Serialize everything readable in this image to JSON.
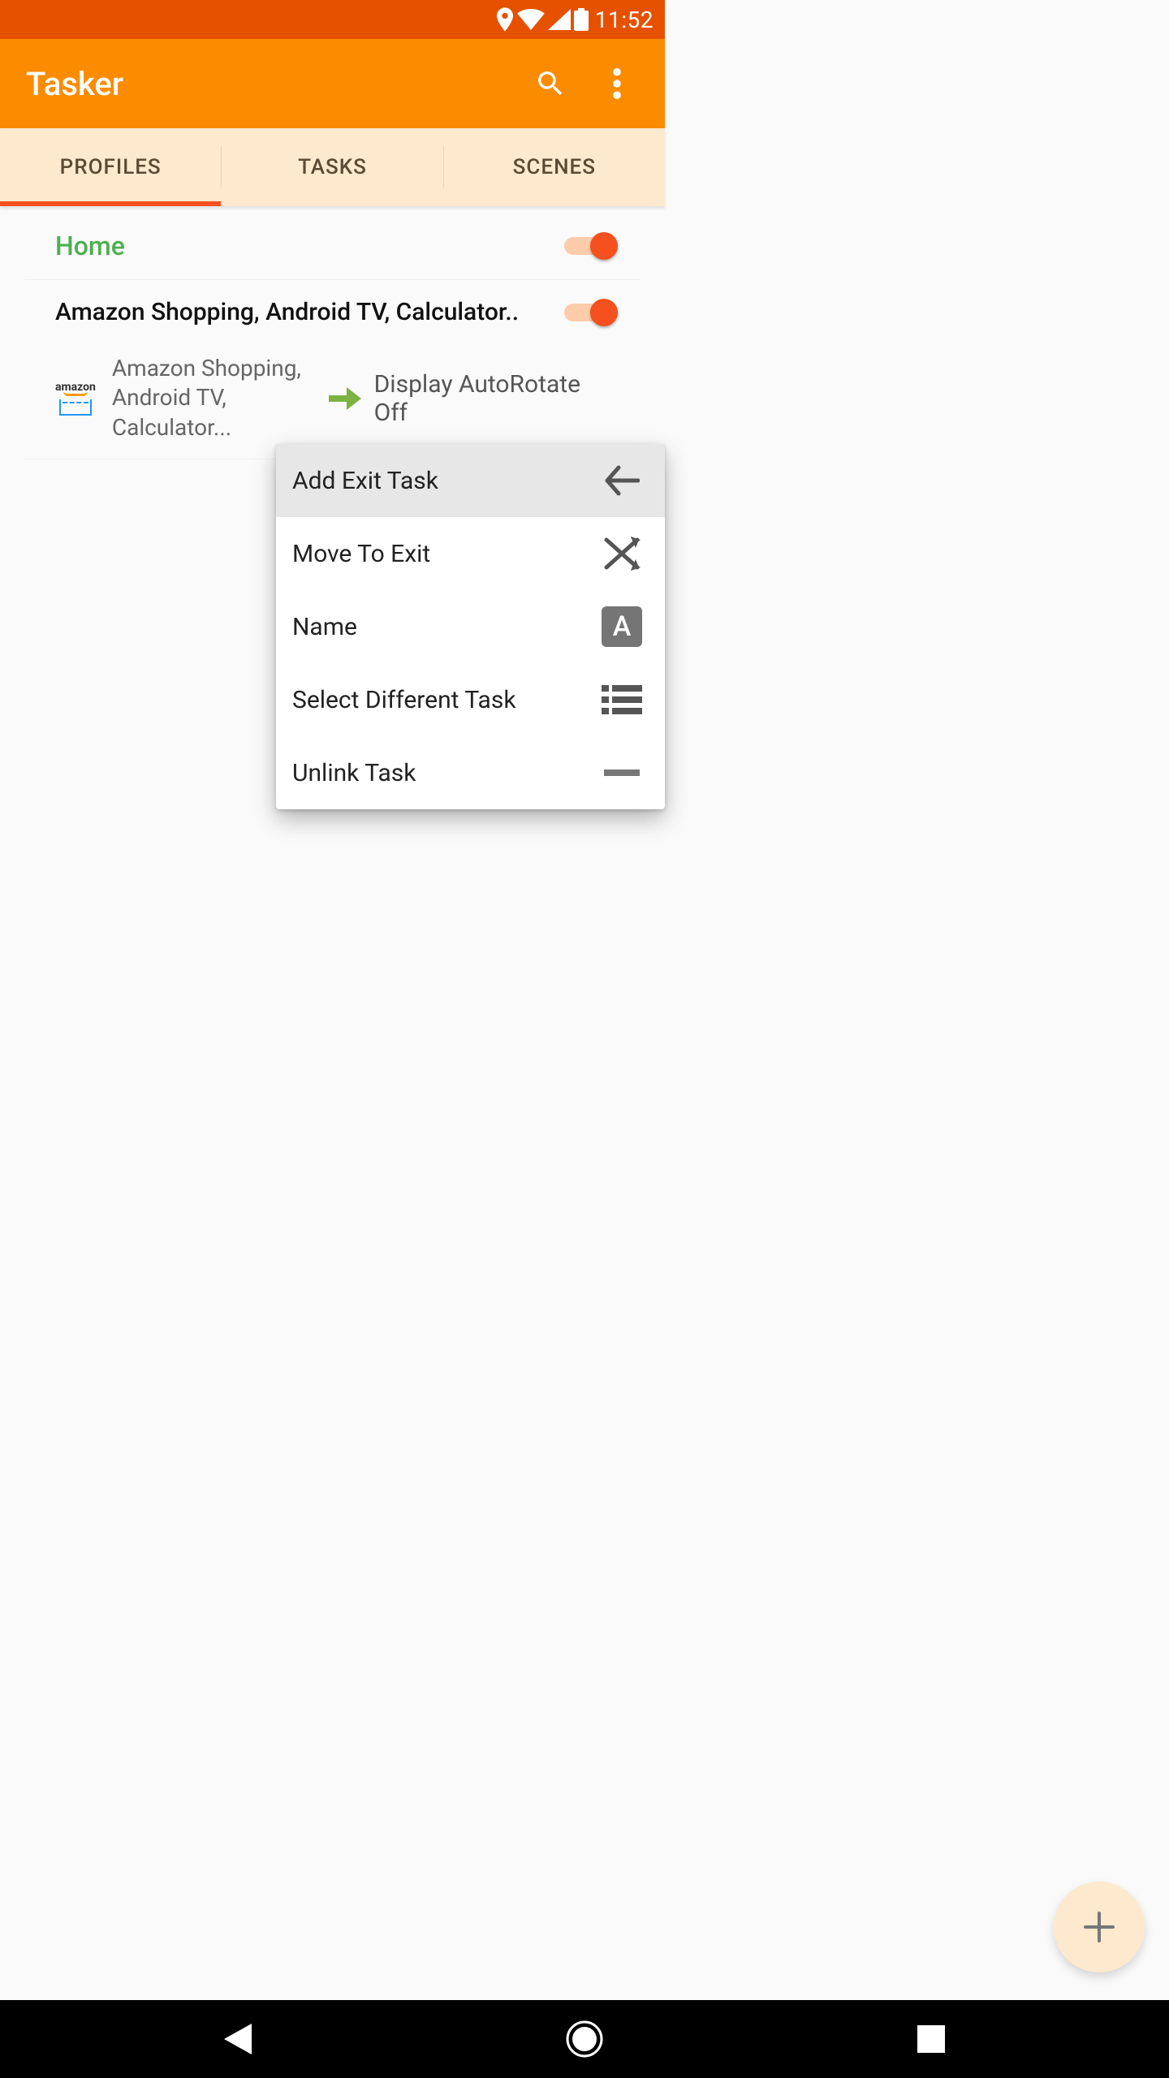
{
  "status": {
    "time": "11:52"
  },
  "appbar": {
    "title": "Tasker"
  },
  "tabs": {
    "items": [
      {
        "label": "PROFILES"
      },
      {
        "label": "TASKS"
      },
      {
        "label": "SCENES"
      }
    ]
  },
  "profiles": {
    "home": {
      "title": "Home"
    },
    "second": {
      "title": "Amazon Shopping, Android TV, Calculator..",
      "detail_left": "Amazon Shopping, Android TV, Calculator...",
      "detail_right": "Display AutoRotate Off"
    }
  },
  "menu": {
    "items": [
      {
        "label": "Add Exit Task"
      },
      {
        "label": "Move To Exit"
      },
      {
        "label": "Name"
      },
      {
        "label": "Select Different Task"
      },
      {
        "label": "Unlink Task"
      }
    ],
    "name_letter": "A"
  }
}
